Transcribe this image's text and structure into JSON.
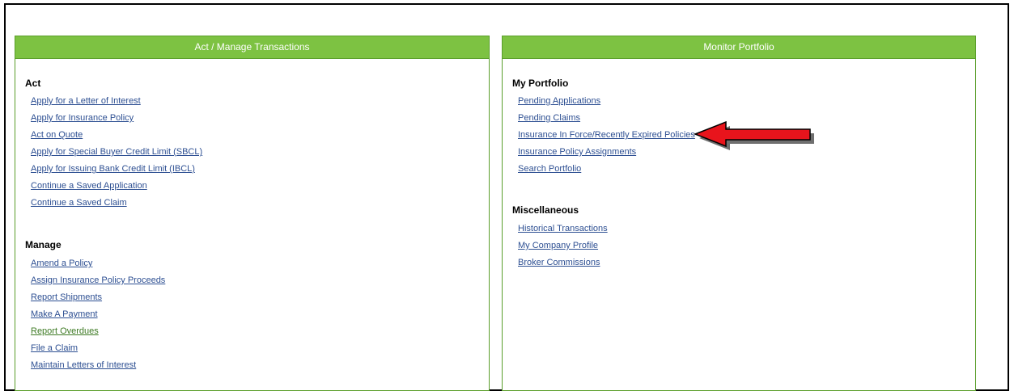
{
  "left_panel": {
    "header": "Act / Manage Transactions",
    "act_title": "Act",
    "act_links": [
      "Apply for a Letter of Interest",
      "Apply for Insurance Policy",
      "Act on Quote",
      "Apply for Special Buyer Credit Limit (SBCL)",
      "Apply for Issuing Bank Credit Limit (IBCL)",
      "Continue a Saved Application",
      "Continue a Saved Claim"
    ],
    "manage_title": "Manage",
    "manage_links": [
      "Amend a Policy",
      "Assign Insurance Policy Proceeds",
      "Report Shipments",
      "Make A Payment",
      "Report Overdues",
      "File a Claim",
      "Maintain Letters of Interest"
    ]
  },
  "right_panel": {
    "header": "Monitor Portfolio",
    "portfolio_title": "My Portfolio",
    "portfolio_links": [
      "Pending Applications",
      "Pending Claims",
      "Insurance In Force/Recently Expired Policies",
      "Insurance Policy Assignments",
      "Search Portfolio"
    ],
    "misc_title": "Miscellaneous",
    "misc_links": [
      "Historical Transactions",
      "My Company Profile",
      "Broker Commissions"
    ]
  },
  "annotation": {
    "icon": "red-arrow-icon",
    "color": "#e8141c"
  },
  "colors": {
    "header_green": "#7dc242",
    "link_blue": "#2d4f92",
    "visited_green": "#3d7a23"
  }
}
